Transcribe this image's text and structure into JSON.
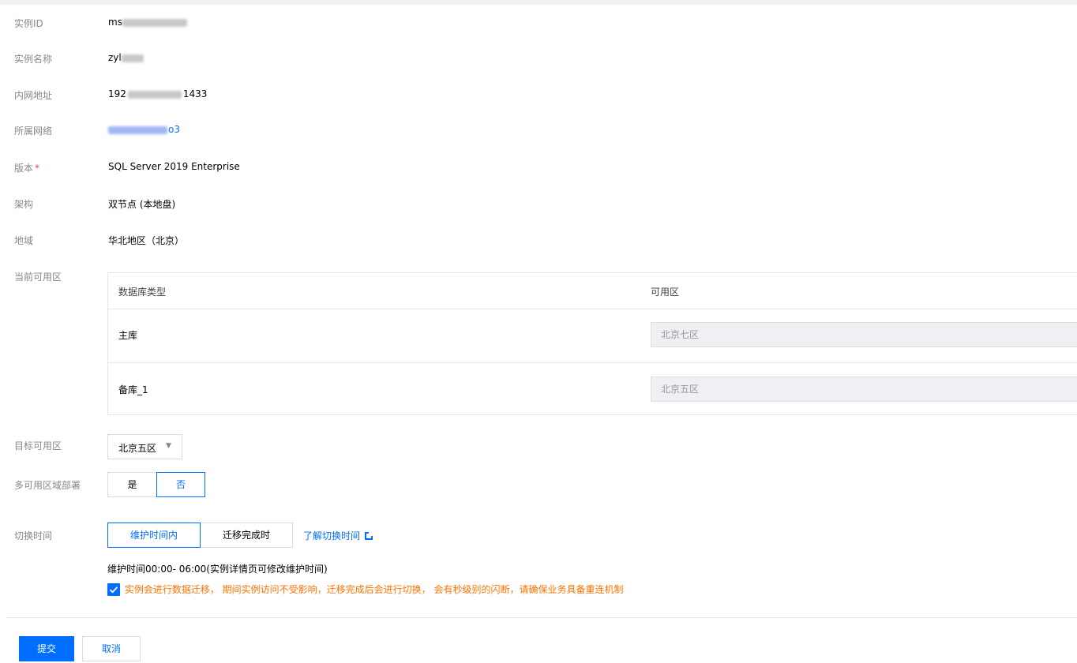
{
  "form": {
    "instance_id": {
      "label": "实例ID",
      "value": "ms"
    },
    "instance_name": {
      "label": "实例名称",
      "value": "zyl"
    },
    "intranet_address": {
      "label": "内网地址",
      "value_start": "192",
      "value_end": "1433"
    },
    "network": {
      "label": "所属网络",
      "value_end": "o3"
    },
    "version": {
      "label": "版本",
      "required_mark": "*",
      "value": "SQL Server 2019 Enterprise"
    },
    "architecture": {
      "label": "架构",
      "value": "双节点 (本地盘)"
    },
    "region": {
      "label": "地域",
      "value": "华北地区（北京）"
    },
    "current_zone": {
      "label": "当前可用区",
      "headers": [
        "数据库类型",
        "可用区"
      ],
      "rows": [
        {
          "db_type": "主库",
          "zone": "北京七区"
        },
        {
          "db_type": "备库_1",
          "zone": "北京五区"
        }
      ]
    },
    "target_zone": {
      "label": "目标可用区",
      "selected": "北京五区",
      "caret": "▼"
    },
    "multi_az": {
      "label": "多可用区域部署",
      "options": [
        "是",
        "否"
      ],
      "selected": "否"
    },
    "switch_time": {
      "label": "切换时间",
      "options": [
        "维护时间内",
        "迁移完成时"
      ],
      "selected": "维护时间内",
      "learn_more": "了解切换时间",
      "maintenance_note": "维护时间00:00- 06:00(实例详情页可修改维护时间)",
      "ack_checked": true,
      "ack_text": "实例会进行数据迁移， 期间实例访问不受影响，迁移完成后会进行切换， 会有秒级别的闪断，请确保业务具备重连机制"
    }
  },
  "actions": {
    "submit": "提交",
    "cancel": "取消"
  },
  "colors": {
    "primary": "#006eff",
    "warning": "#ff7200",
    "label": "#888888",
    "disabled_bg": "#eef0f3"
  }
}
